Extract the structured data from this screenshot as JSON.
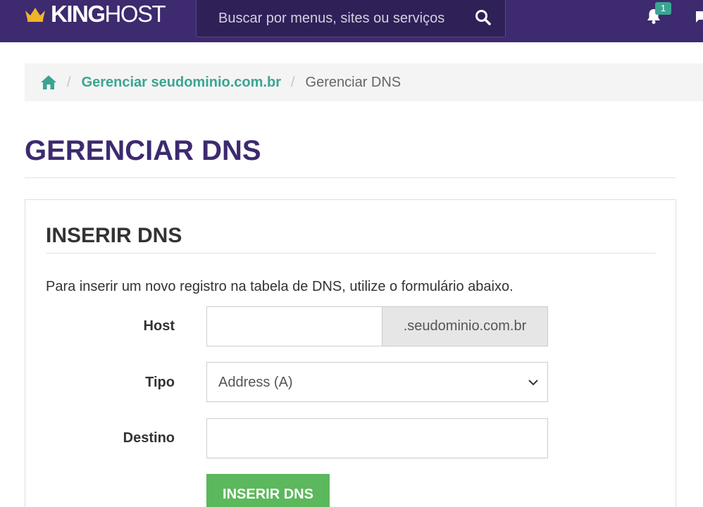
{
  "header": {
    "logo_king": "KING",
    "logo_host": "HOST",
    "search_placeholder": "Buscar por menus, sites ou serviços",
    "notification_count": "1",
    "icons": [
      "crown-icon",
      "search-icon",
      "bell-icon",
      "chat-icon"
    ],
    "colors": {
      "bar": "#3d2a6f",
      "accent": "#3aa592",
      "crown": "#f0b429"
    }
  },
  "breadcrumb": {
    "items": [
      {
        "label": "Gerenciar seudominio.com.br"
      },
      {
        "label": "Gerenciar DNS"
      }
    ],
    "separator": "/"
  },
  "page": {
    "title": "GERENCIAR DNS"
  },
  "panel": {
    "title": "INSERIR DNS",
    "description": "Para inserir um novo registro na tabela de DNS, utilize o formulário abaixo.",
    "host": {
      "label": "Host",
      "value": "",
      "suffix": ".seudominio.com.br"
    },
    "tipo": {
      "label": "Tipo",
      "selected": "Address (A)"
    },
    "destino": {
      "label": "Destino",
      "value": ""
    },
    "submit_label": "INSERIR DNS",
    "colors": {
      "submit": "#5cb85c"
    }
  }
}
